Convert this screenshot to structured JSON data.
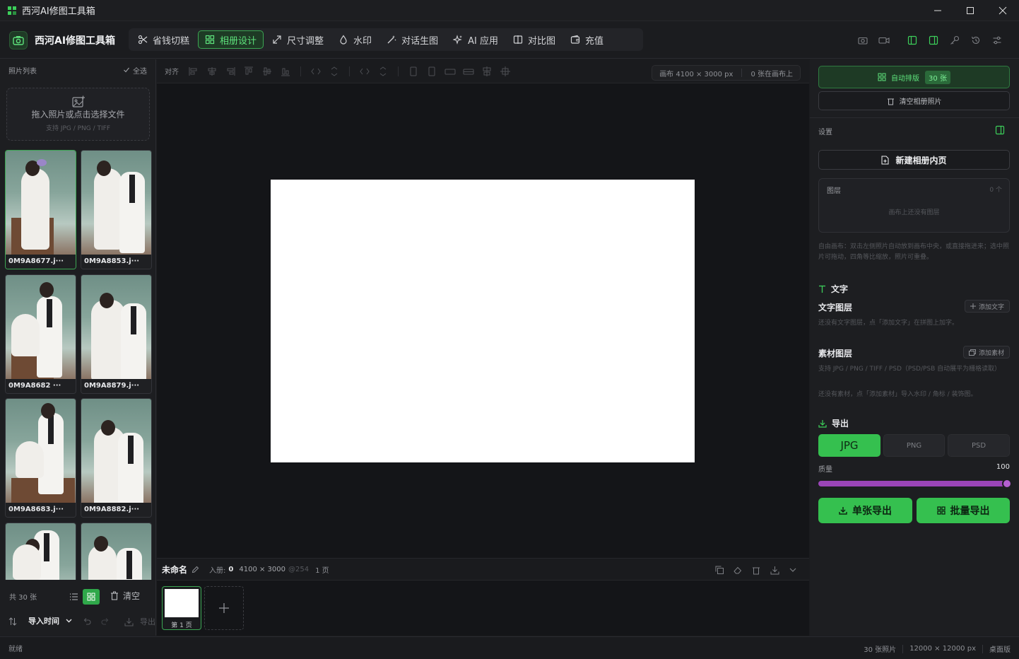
{
  "window": {
    "title": "西河AI修图工具箱"
  },
  "app": {
    "brand": "西河AI修图工具箱"
  },
  "nav": [
    {
      "label": "省钱切糕",
      "icon": "scissors-icon"
    },
    {
      "label": "相册设计",
      "icon": "grid-icon",
      "active": true
    },
    {
      "label": "尺寸调整",
      "icon": "resize-icon"
    },
    {
      "label": "水印",
      "icon": "droplet-icon"
    },
    {
      "label": "对话生图",
      "icon": "magic-wand-icon"
    },
    {
      "label": "AI 应用",
      "icon": "sparkle-icon"
    },
    {
      "label": "对比图",
      "icon": "compare-icon"
    },
    {
      "label": "充值",
      "icon": "wallet-icon"
    }
  ],
  "left": {
    "title": "照片列表",
    "select_all": "全选",
    "drop_main": "拖入照片或点击选择文件",
    "drop_sub": "支持 JPG / PNG / TIFF",
    "photos": [
      "0M9A8677.j···",
      "0M9A8853.j···",
      "0M9A8682 ···",
      "0M9A8879.j···",
      "0M9A8683.j···",
      "0M9A8882.j···",
      "",
      ""
    ],
    "count": "共 30 张",
    "clear": "清空",
    "sort": "导入时间",
    "export": "导出"
  },
  "align": {
    "label": "对齐"
  },
  "canvas_info": {
    "size": "画布 4100 × 3000 px",
    "count": "0 张在画布上"
  },
  "pagebar": {
    "name": "未命名",
    "meta_label": "入册:",
    "meta_value": "0",
    "dims": "4100 × 3000",
    "dpi": "@254",
    "pages": "1 页"
  },
  "page_thumb": {
    "label": "第 1 页"
  },
  "right": {
    "auto_layout": "自动排版",
    "auto_badge": "30 张",
    "clear_album": "清空相册照片",
    "settings": "设置",
    "new_page": "新建相册内页",
    "layers_title": "图层",
    "layers_count": "0 个",
    "layers_empty": "画布上还没有图层",
    "free_hint": "自由画布：双击左侧照片自动放到画布中央，或直接拖进来；选中照片可拖动，四角等比缩放，照片可重叠。",
    "text_section": "文字",
    "text_layer": "文字图层",
    "add_text": "添加文字",
    "text_hint": "还没有文字图层，点「添加文字」在拼图上加字。",
    "asset_layer": "素材图层",
    "add_asset": "添加素材",
    "asset_hint1": "支持 JPG / PNG / TIFF / PSD（PSD/PSB 自动展平为栅格读取）",
    "asset_hint2": "还没有素材，点「添加素材」导入水印 / 角标 / 装饰图。",
    "export_section": "导出",
    "formats": [
      "JPG",
      "PNG",
      "PSD"
    ],
    "quality_label": "质量",
    "quality_value": "100",
    "single_export": "单张导出",
    "batch_export": "批量导出"
  },
  "status": {
    "left": "就绪",
    "photos": "30 张照片",
    "max": "12000 × 12000 px",
    "edition": "桌面版"
  },
  "colors": {
    "accent": "#35c04f",
    "slider": "#9b45b8"
  }
}
